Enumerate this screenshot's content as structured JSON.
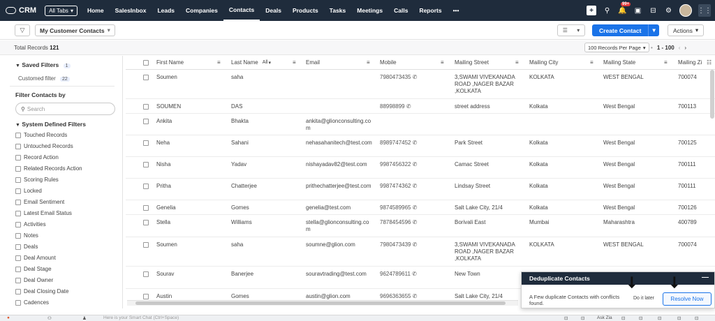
{
  "brand": {
    "name": "CRM"
  },
  "nav": {
    "alltabs": "All Tabs",
    "tabs": [
      "Home",
      "SalesInbox",
      "Leads",
      "Companies",
      "Contacts",
      "Deals",
      "Products",
      "Tasks",
      "Meetings",
      "Calls",
      "Reports",
      "•••"
    ],
    "notif_count": "99+"
  },
  "toolbar": {
    "view": "My Customer Contacts",
    "create": "Create Contact",
    "actions": "Actions"
  },
  "records": {
    "total_label": "Total Records",
    "total_value": "121",
    "per_page": "100 Records Per Page",
    "range": "1 - 100"
  },
  "sidebar": {
    "saved_filters": "Saved Filters",
    "saved_count": "1",
    "customed_filter": "Customed filter",
    "customed_count": "22",
    "filter_by": "Filter Contacts by",
    "search_placeholder": "Search",
    "system_filters": "System Defined Filters",
    "items": [
      "Touched Records",
      "Untouched Records",
      "Record Action",
      "Related Records Action",
      "Scoring Rules",
      "Locked",
      "Email Sentiment",
      "Latest Email Status",
      "Activities",
      "Notes",
      "Deals",
      "Deal Amount",
      "Deal Stage",
      "Deal Owner",
      "Deal Closing Date",
      "Cadences"
    ]
  },
  "table": {
    "headers": [
      "First Name",
      "Last Name",
      "Email",
      "Mobile",
      "Mailing Street",
      "Mailing City",
      "Mailing State",
      "Mailing Zi"
    ],
    "lastname_filter": "All",
    "rows": [
      {
        "first": "Soumen",
        "last": "saha",
        "email": "",
        "mobile": "7980473435",
        "street": "3,SWAMI VIVEKANADA ROAD ,NAGER BAZAR ,KOLKATA",
        "city": "KOLKATA",
        "state": "WEST BENGAL",
        "zip": "700074"
      },
      {
        "first": "SOUMEN",
        "last": "DAS",
        "email": "",
        "mobile": "88998899",
        "street": "street address",
        "city": "Kolkata",
        "state": "West Bengal",
        "zip": "700113"
      },
      {
        "first": "Ankita",
        "last": "Bhakta",
        "email": "ankita@glionconsulting.com",
        "mobile": "",
        "street": "",
        "city": "",
        "state": "",
        "zip": ""
      },
      {
        "first": "Neha",
        "last": "Sahani",
        "email": "nehasahanitech@test.com",
        "mobile": "8989747452",
        "street": "Park Street",
        "city": "Kolkata",
        "state": "West Bengal",
        "zip": "700125"
      },
      {
        "first": "Nisha",
        "last": "Yadav",
        "email": "nishayadav82@test.com",
        "mobile": "9987456322",
        "street": "Camac Street",
        "city": "Kolkata",
        "state": "West Bengal",
        "zip": "700111"
      },
      {
        "first": "Pritha",
        "last": "Chatterjee",
        "email": "prithechatterjee@test.com",
        "mobile": "9987474362",
        "street": "Lindsay Street",
        "city": "Kolkata",
        "state": "West Bengal",
        "zip": "700111"
      },
      {
        "first": "Genelia",
        "last": "Gomes",
        "email": "genelia@test.com",
        "mobile": "9874589965",
        "street": "Salt Lake City, 21/4",
        "city": "Kolkata",
        "state": "West Bengal",
        "zip": "700126"
      },
      {
        "first": "Stella",
        "last": "Williams",
        "email": "stella@glionconsulting.com",
        "mobile": "7878454596",
        "street": "Borivali East",
        "city": "Mumbai",
        "state": "Maharashtra",
        "zip": "400789"
      },
      {
        "first": "Soumen",
        "last": "saha",
        "email": "soumne@glion.com",
        "mobile": "7980473439",
        "street": "3,SWAMI VIVEKANADA ROAD ,NAGER BAZAR ,KOLKATA",
        "city": "KOLKATA",
        "state": "WEST BENGAL",
        "zip": "700074"
      },
      {
        "first": "Sourav",
        "last": "Banerjee",
        "email": "souravtrading@test.com",
        "mobile": "9624789611",
        "street": "New Town",
        "city": "",
        "state": "",
        "zip": ""
      },
      {
        "first": "Austin",
        "last": "Gomes",
        "email": "austin@glion.com",
        "mobile": "9696363655",
        "street": "Salt Lake City, 21/4",
        "city": "",
        "state": "",
        "zip": ""
      }
    ]
  },
  "popup": {
    "title": "Deduplicate Contacts",
    "message": "A Few duplicate Contacts with conflicts found.",
    "later": "Do it later",
    "resolve": "Resolve Now"
  },
  "bottombar": {
    "chat_placeholder": "Here is your Smart Chat (Ctrl+Space)",
    "ask": "Ask Zia"
  },
  "colors": {
    "topbar": "#1f2c3c",
    "accent": "#1a73e8"
  }
}
